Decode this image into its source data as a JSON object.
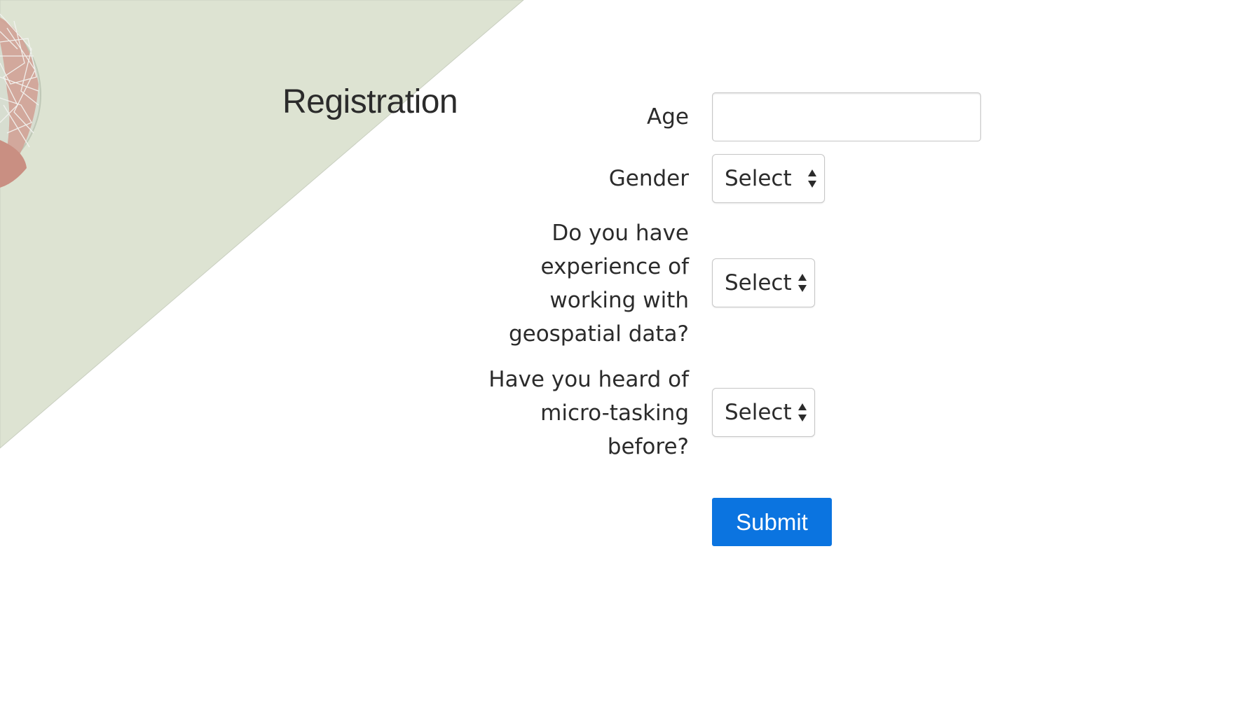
{
  "page": {
    "title": "Registration",
    "background_color": "#ffffff",
    "decor_color": "#dde3d2",
    "accent_color": "#0b74e0"
  },
  "form": {
    "age": {
      "label": "Age",
      "value": "",
      "placeholder": ""
    },
    "gender": {
      "label": "Gender",
      "selected": "Select"
    },
    "geospatial_experience": {
      "label": "Do you have experience of working with geospatial data?",
      "selected": "Select"
    },
    "microtasking_heard": {
      "label": "Have you heard of micro-tasking before?",
      "selected": "Select"
    },
    "submit_label": "Submit"
  },
  "icons": {
    "globe": "globe-icon",
    "select_arrows": "up-down-arrows-icon"
  }
}
